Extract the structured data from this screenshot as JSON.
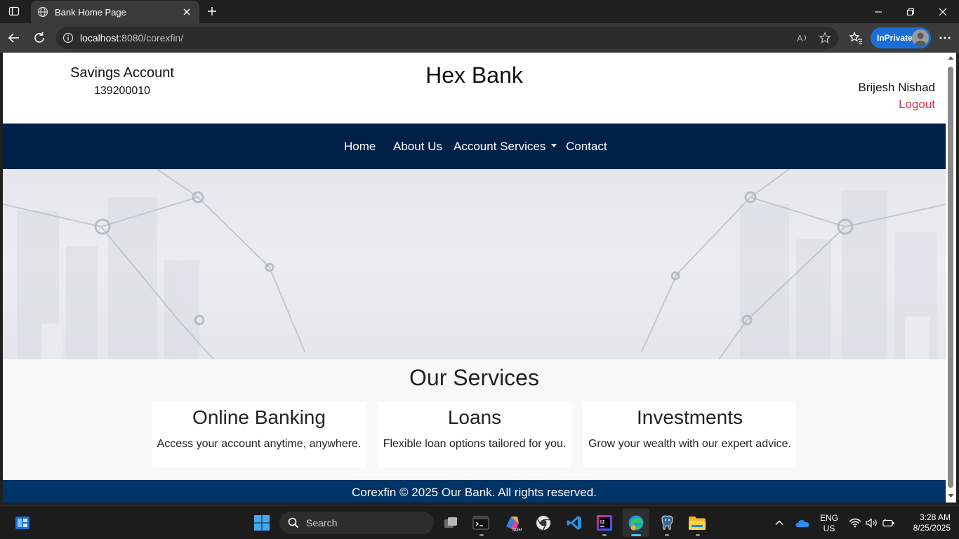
{
  "browser": {
    "tab_title": "Bank Home Page",
    "url_host": "localhost",
    "url_rest": ":8080/corexfin/",
    "inprivate_label": "InPrivate"
  },
  "header": {
    "account_type": "Savings Account",
    "account_number": "139200010",
    "bank_name": "Hex Bank",
    "user_name": "Brijesh Nishad",
    "logout_label": "Logout"
  },
  "nav": {
    "items": [
      {
        "label": "Home"
      },
      {
        "label": "About Us"
      },
      {
        "label": "Account Services"
      },
      {
        "label": "Contact"
      }
    ]
  },
  "services": {
    "title": "Our Services",
    "cards": [
      {
        "title": "Online Banking",
        "desc": "Access your account anytime, anywhere."
      },
      {
        "title": "Loans",
        "desc": "Flexible loan options tailored for you."
      },
      {
        "title": "Investments",
        "desc": "Grow your wealth with our expert advice."
      }
    ]
  },
  "footer": {
    "text": "Corexfin © 2025 Our Bank. All rights reserved."
  },
  "colors": {
    "nav_bg": "#002147",
    "footer_bg": "#003366",
    "logout": "#dc3545",
    "inprivate": "#1a6ed8"
  },
  "taskbar": {
    "search_label": "Search",
    "lang_1": "ENG",
    "lang_2": "US",
    "time": "3:28 AM",
    "date": "8/25/2025",
    "icons": [
      "start-icon",
      "search-icon",
      "task-view-icon",
      "terminal-icon",
      "m365-icon",
      "chrome-like-icon",
      "vscode-icon",
      "intellij-icon",
      "edge-icon",
      "postgres-icon",
      "file-explorer-icon"
    ]
  }
}
